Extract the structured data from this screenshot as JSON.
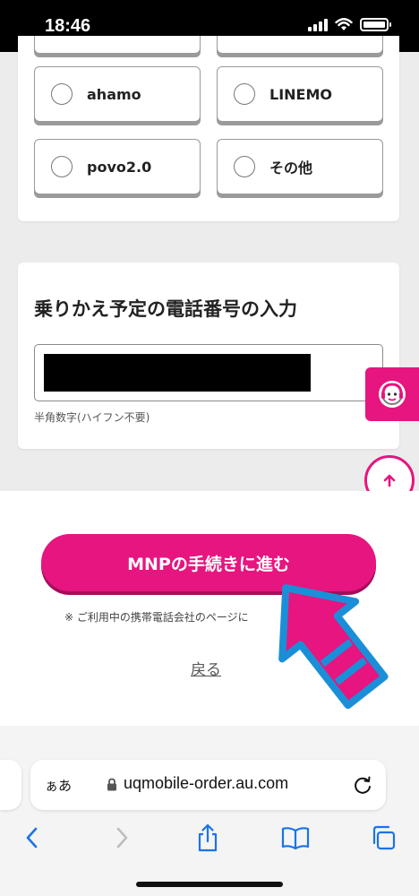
{
  "status_bar": {
    "time": "18:46"
  },
  "carrier_options": [
    {
      "label": "ahamo"
    },
    {
      "label": "LINEMO"
    },
    {
      "label": "povo2.0"
    },
    {
      "label": "その他"
    }
  ],
  "phone_section": {
    "title": "乗りかえ予定の電話番号の入力",
    "hint": "半角数字(ハイフン不要)"
  },
  "actions": {
    "mnp_button": "MNPの手続きに進む",
    "note": "※ ご利用中の携帯電話会社のページに",
    "back_link": "戻る"
  },
  "browser": {
    "aa_label": "ぁあ",
    "url": "uqmobile-order.au.com"
  },
  "colors": {
    "accent": "#e6157f",
    "arrow_fill": "#e6157f",
    "arrow_outline": "#1a8fd8"
  },
  "icons": {
    "chat": "support-agent-icon",
    "scroll_top": "arrow-up-icon",
    "back": "chevron-left-icon",
    "forward": "chevron-right-icon",
    "share": "share-icon",
    "bookmarks": "book-icon",
    "tabs": "tabs-icon"
  }
}
